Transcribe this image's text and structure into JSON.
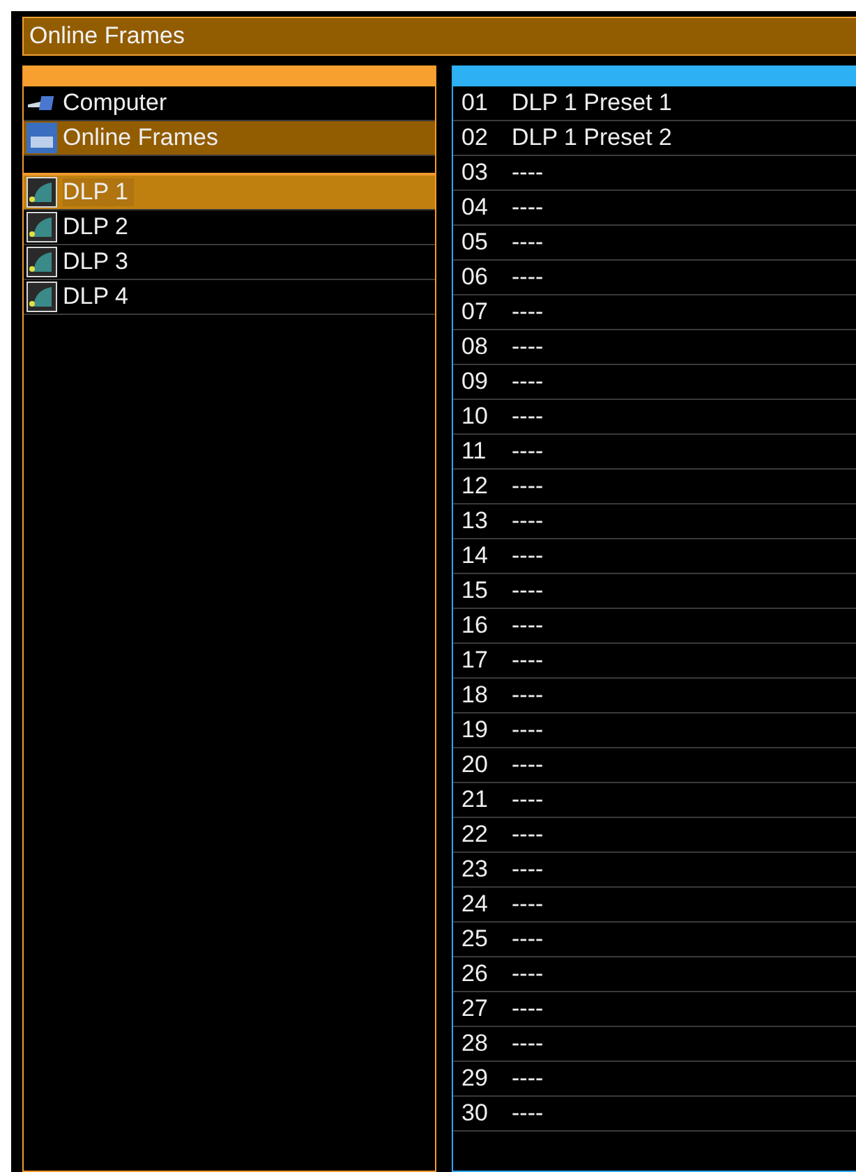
{
  "window": {
    "title": "Online Frames"
  },
  "sources": [
    {
      "label": "Computer",
      "kind": "computer",
      "selected": false
    },
    {
      "label": "Online Frames",
      "kind": "lake",
      "selected": true
    }
  ],
  "frames": [
    {
      "label": "DLP 1",
      "selected": true
    },
    {
      "label": "DLP 2",
      "selected": false
    },
    {
      "label": "DLP 3",
      "selected": false
    },
    {
      "label": "DLP 4",
      "selected": false
    }
  ],
  "presets": [
    {
      "number": "01",
      "name": "DLP 1 Preset 1"
    },
    {
      "number": "02",
      "name": "DLP 1 Preset 2"
    },
    {
      "number": "03",
      "name": "----"
    },
    {
      "number": "04",
      "name": "----"
    },
    {
      "number": "05",
      "name": "----"
    },
    {
      "number": "06",
      "name": "----"
    },
    {
      "number": "07",
      "name": "----"
    },
    {
      "number": "08",
      "name": "----"
    },
    {
      "number": "09",
      "name": "----"
    },
    {
      "number": "10",
      "name": "----"
    },
    {
      "number": "11",
      "name": "----"
    },
    {
      "number": "12",
      "name": "----"
    },
    {
      "number": "13",
      "name": "----"
    },
    {
      "number": "14",
      "name": "----"
    },
    {
      "number": "15",
      "name": "----"
    },
    {
      "number": "16",
      "name": "----"
    },
    {
      "number": "17",
      "name": "----"
    },
    {
      "number": "18",
      "name": "----"
    },
    {
      "number": "19",
      "name": "----"
    },
    {
      "number": "20",
      "name": "----"
    },
    {
      "number": "21",
      "name": "----"
    },
    {
      "number": "22",
      "name": "----"
    },
    {
      "number": "23",
      "name": "----"
    },
    {
      "number": "24",
      "name": "----"
    },
    {
      "number": "25",
      "name": "----"
    },
    {
      "number": "26",
      "name": "----"
    },
    {
      "number": "27",
      "name": "----"
    },
    {
      "number": "28",
      "name": "----"
    },
    {
      "number": "29",
      "name": "----"
    },
    {
      "number": "30",
      "name": "----"
    }
  ]
}
